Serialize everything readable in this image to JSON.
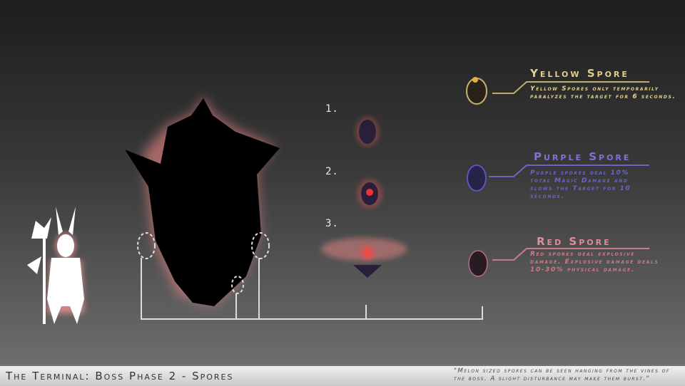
{
  "steps": [
    "1.",
    "2.",
    "3."
  ],
  "spores": [
    {
      "title": "Yellow Spore",
      "desc": "Yellow Spores only temporarily paralyzes the target for 6 seconds.",
      "color": "#e3cf8a",
      "line": "#bfae6a"
    },
    {
      "title": "Purple Spore",
      "desc": "Purple spores deal 10% total Magic Damage and slows the Target for 10 seconds.",
      "color": "#7b74d6",
      "line": "#6a64c4"
    },
    {
      "title": "Red Spore",
      "desc": "Red spores deal explosive damage. Explosive damage deals 10-30% physical damage.",
      "color": "#e08c9a",
      "line": "#c87c88"
    }
  ],
  "footer": {
    "title": "The Terminal: Boss Phase 2 - Spores",
    "quote": "\"Melon sized spores can be seen hanging from the vines of the boss.  A slight disturbance may make them burst.\""
  }
}
